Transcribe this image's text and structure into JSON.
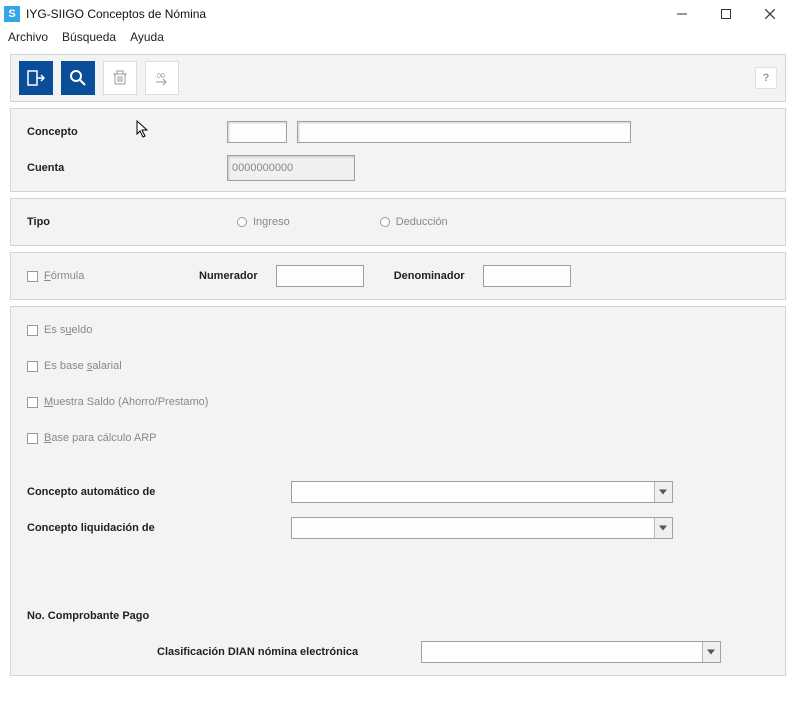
{
  "window": {
    "title": "IYG-SIIGO Conceptos de Nómina",
    "app_icon_letter": "S"
  },
  "menubar": {
    "archivo": "Archivo",
    "busqueda": "Búsqueda",
    "ayuda": "Ayuda"
  },
  "toolbar": {
    "exit_icon": "exit-icon",
    "search_icon": "search-icon",
    "delete_icon": "trash-icon",
    "decimal_icon": "decimal-icon",
    "help_label": "?"
  },
  "panel_concepto": {
    "concepto_label": "Concepto",
    "concepto_code_value": "",
    "concepto_desc_value": "",
    "cuenta_label": "Cuenta",
    "cuenta_value": "0000000000"
  },
  "panel_tipo": {
    "tipo_label": "Tipo",
    "ingreso_label": "Ingreso",
    "deduccion_label": "Deducción"
  },
  "panel_formula": {
    "formula_label": "Fórmula",
    "numerador_label": "Numerador",
    "numerador_value": "",
    "denominador_label": "Denominador",
    "denominador_value": ""
  },
  "panel_options": {
    "es_sueldo": "Es sueldo",
    "es_base_salarial": "Es base salarial",
    "muestra_saldo": "Muestra Saldo (Ahorro/Prestamo)",
    "base_arp": "Base para cálculo ARP",
    "concepto_auto_label": "Concepto automático de",
    "concepto_auto_value": "",
    "concepto_liq_label": "Concepto liquidación de",
    "concepto_liq_value": "",
    "no_comprobante_label": "No. Comprobante Pago",
    "clasificacion_dian_label": "Clasificación DIAN nómina electrónica",
    "clasificacion_dian_value": ""
  }
}
